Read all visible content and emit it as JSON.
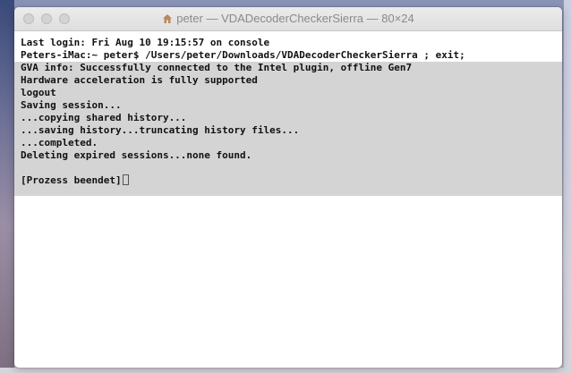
{
  "window": {
    "title": "peter — VDADecoderCheckerSierra — 80×24",
    "title_icon": "home-folder-icon"
  },
  "terminal": {
    "lines_unselected": [
      "Last login: Fri Aug 10 19:15:57 on console",
      "Peters-iMac:~ peter$ /Users/peter/Downloads/VDADecoderCheckerSierra ; exit;"
    ],
    "lines_selected": [
      "GVA info: Successfully connected to the Intel plugin, offline Gen7",
      "Hardware acceleration is fully supported",
      "logout",
      "Saving session...",
      "...copying shared history...",
      "...saving history...truncating history files...",
      "...completed.",
      "Deleting expired sessions...none found.",
      "",
      "[Prozess beendet]"
    ]
  },
  "colors": {
    "selection": "#d4d4d4",
    "text": "#111111"
  }
}
